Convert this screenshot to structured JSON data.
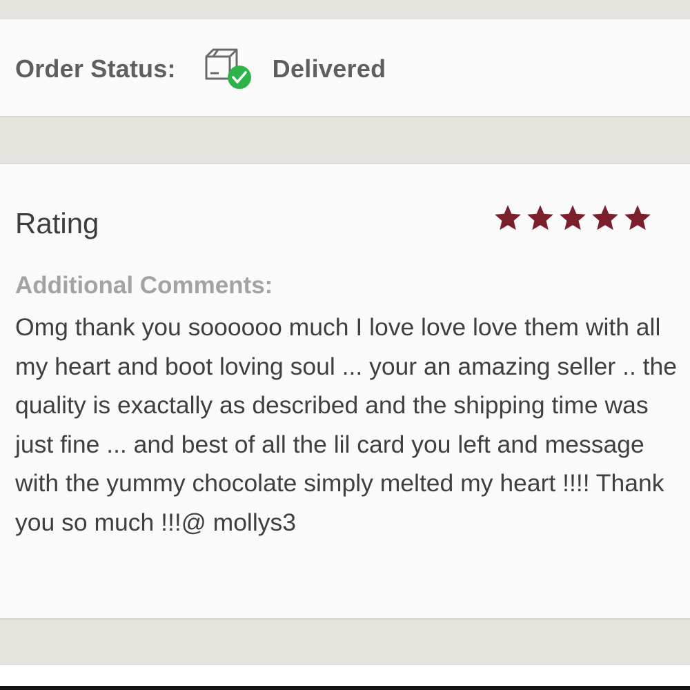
{
  "order_status": {
    "label": "Order Status:",
    "value": "Delivered",
    "icon": "delivered-box-check-icon",
    "check_color": "#2db34a"
  },
  "rating": {
    "label": "Rating",
    "stars": 5,
    "max_stars": 5,
    "star_color": "#7a1f2b"
  },
  "comments": {
    "label": "Additional Comments:",
    "text": "Omg thank you soooooo much I love love love them with all my heart and boot loving soul ... your an amazing seller .. the quality is exactally as described and the shipping time was just fine ... and best of all the lil card you left and message with the yummy chocolate simply melted my heart !!!! Thank you so much !!!@ mollys3"
  }
}
